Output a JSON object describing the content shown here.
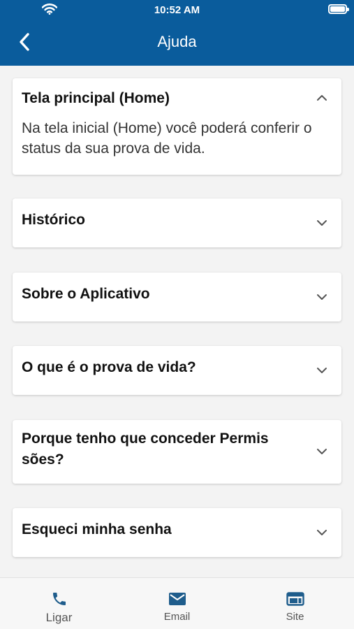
{
  "status_bar": {
    "time": "10:52 AM"
  },
  "header": {
    "title": "Ajuda"
  },
  "faq": [
    {
      "title": "Tela principal (Home)",
      "expanded": true,
      "body": "Na tela inicial (Home) você poderá conferir o status da sua prova de vida."
    },
    {
      "title": "Histórico",
      "expanded": false
    },
    {
      "title": "Sobre o Aplicativo",
      "expanded": false
    },
    {
      "title": "O que é o prova de vida?",
      "expanded": false
    },
    {
      "title": "Porque tenho que conceder Permis sões?",
      "expanded": false
    },
    {
      "title": "Esqueci minha senha",
      "expanded": false
    }
  ],
  "bottom_nav": [
    {
      "label": "Ligar",
      "icon": "phone-icon"
    },
    {
      "label": "Email",
      "icon": "mail-icon"
    },
    {
      "label": "Site",
      "icon": "web-icon"
    }
  ],
  "colors": {
    "brand": "#0a5c9c",
    "icon": "#1f5d8c"
  }
}
